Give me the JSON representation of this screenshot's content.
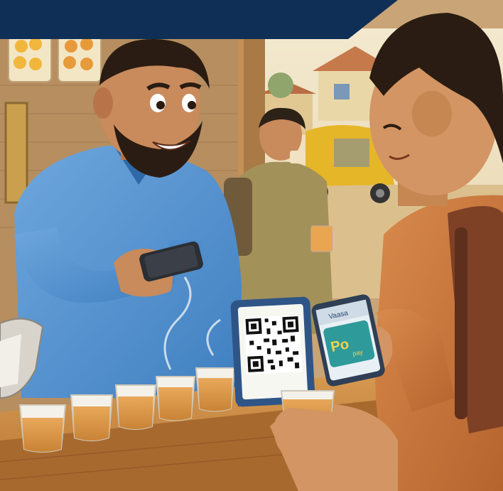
{
  "scene": {
    "phone_header_text": "Vaasa",
    "phone_pay_text": "Po",
    "phone_pay_subtext": "pay"
  }
}
